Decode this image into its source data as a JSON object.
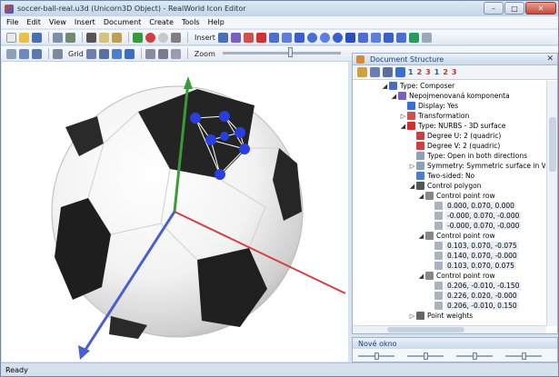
{
  "window": {
    "title": "soccer-ball-real.u3d (Unicorn3D Object) - RealWorld Icon Editor",
    "minimize": "–",
    "maximize": "□",
    "close": "✕"
  },
  "menu": [
    "File",
    "Edit",
    "View",
    "Insert",
    "Document",
    "Create",
    "Tools",
    "Help"
  ],
  "toolbar1": {
    "insert_label": "Insert"
  },
  "toolbar2": {
    "grid_label": "Grid",
    "zoom_label": "Zoom"
  },
  "panel": {
    "title": "Document Structure",
    "close": "✕",
    "buttons": [
      "1",
      "2",
      "3",
      "1",
      "2",
      "3"
    ],
    "tree": [
      {
        "indent": 0,
        "expander": "◢",
        "icon": "composer-icon",
        "color": "#4a6fb5",
        "text": "Type: Composer"
      },
      {
        "indent": 1,
        "expander": "◢",
        "icon": "component-icon",
        "color": "#7a5fc0",
        "text": "Nepojmenovaná komponenta"
      },
      {
        "indent": 2,
        "expander": "",
        "icon": "display-icon",
        "color": "#3a6fcf",
        "text": "Display: Yes"
      },
      {
        "indent": 2,
        "expander": "▷",
        "icon": "transformation-icon",
        "color": "#d05050",
        "text": "Transformation"
      },
      {
        "indent": 2,
        "expander": "◢",
        "icon": "nurbs-icon",
        "color": "#d03030",
        "text": "Type: NURBS - 3D surface"
      },
      {
        "indent": 3,
        "expander": "",
        "icon": "pencil-icon",
        "color": "#c84040",
        "text": "Degree U: 2 (quadric)"
      },
      {
        "indent": 3,
        "expander": "",
        "icon": "pencil-icon",
        "color": "#c84040",
        "text": "Degree V: 2 (quadric)"
      },
      {
        "indent": 3,
        "expander": "",
        "icon": "type-icon",
        "color": "#8da0b8",
        "text": "Type: Open in both directions"
      },
      {
        "indent": 3,
        "expander": "▷",
        "icon": "symmetry-icon",
        "color": "#8da0b8",
        "text": "Symmetry: Symmetric surface in V"
      },
      {
        "indent": 3,
        "expander": "",
        "icon": "two-sided-icon",
        "color": "#4a7fd0",
        "text": "Two-sided: No"
      },
      {
        "indent": 3,
        "expander": "◢",
        "icon": "control-polygon-icon",
        "color": "#555555",
        "text": "Control polygon"
      },
      {
        "indent": 4,
        "expander": "◢",
        "icon": "row-icon",
        "color": "#888888",
        "text": "Control point row"
      },
      {
        "indent": 5,
        "expander": "",
        "icon": "point-icon",
        "color": "#aab4c0",
        "text": "0.000, 0.070, 0.000",
        "value": true
      },
      {
        "indent": 5,
        "expander": "",
        "icon": "point-icon",
        "color": "#aab4c0",
        "text": "-0.000, 0.070, -0.000",
        "value": true
      },
      {
        "indent": 5,
        "expander": "",
        "icon": "point-icon",
        "color": "#aab4c0",
        "text": "-0.000, 0.070, -0.000",
        "value": true
      },
      {
        "indent": 4,
        "expander": "◢",
        "icon": "row-icon",
        "color": "#888888",
        "text": "Control point row"
      },
      {
        "indent": 5,
        "expander": "",
        "icon": "point-icon",
        "color": "#aab4c0",
        "text": "0.103, 0.070, -0.075",
        "value": true
      },
      {
        "indent": 5,
        "expander": "",
        "icon": "point-icon",
        "color": "#aab4c0",
        "text": "0.140, 0.070, -0.000",
        "value": true
      },
      {
        "indent": 5,
        "expander": "",
        "icon": "point-icon",
        "color": "#aab4c0",
        "text": "0.103, 0.070, 0.075",
        "value": true
      },
      {
        "indent": 4,
        "expander": "◢",
        "icon": "row-icon",
        "color": "#888888",
        "text": "Control point row"
      },
      {
        "indent": 5,
        "expander": "",
        "icon": "point-icon",
        "color": "#aab4c0",
        "text": "0.206, -0.010, -0.150",
        "value": true
      },
      {
        "indent": 5,
        "expander": "",
        "icon": "point-icon",
        "color": "#aab4c0",
        "text": "0.226, 0.020, -0.000",
        "value": true
      },
      {
        "indent": 5,
        "expander": "",
        "icon": "point-icon",
        "color": "#aab4c0",
        "text": "0.206, -0.010, 0.150",
        "value": true
      },
      {
        "indent": 3,
        "expander": "▷",
        "icon": "weights-icon",
        "color": "#666666",
        "text": "Point weights"
      }
    ]
  },
  "panel2": {
    "title": "Nové okno"
  },
  "status": {
    "text": "Ready"
  },
  "colors": {
    "x_axis": "#d04040",
    "y_axis": "#3a9a3a",
    "z_axis": "#4a5fd0",
    "control_point": "#2a3fe0"
  }
}
